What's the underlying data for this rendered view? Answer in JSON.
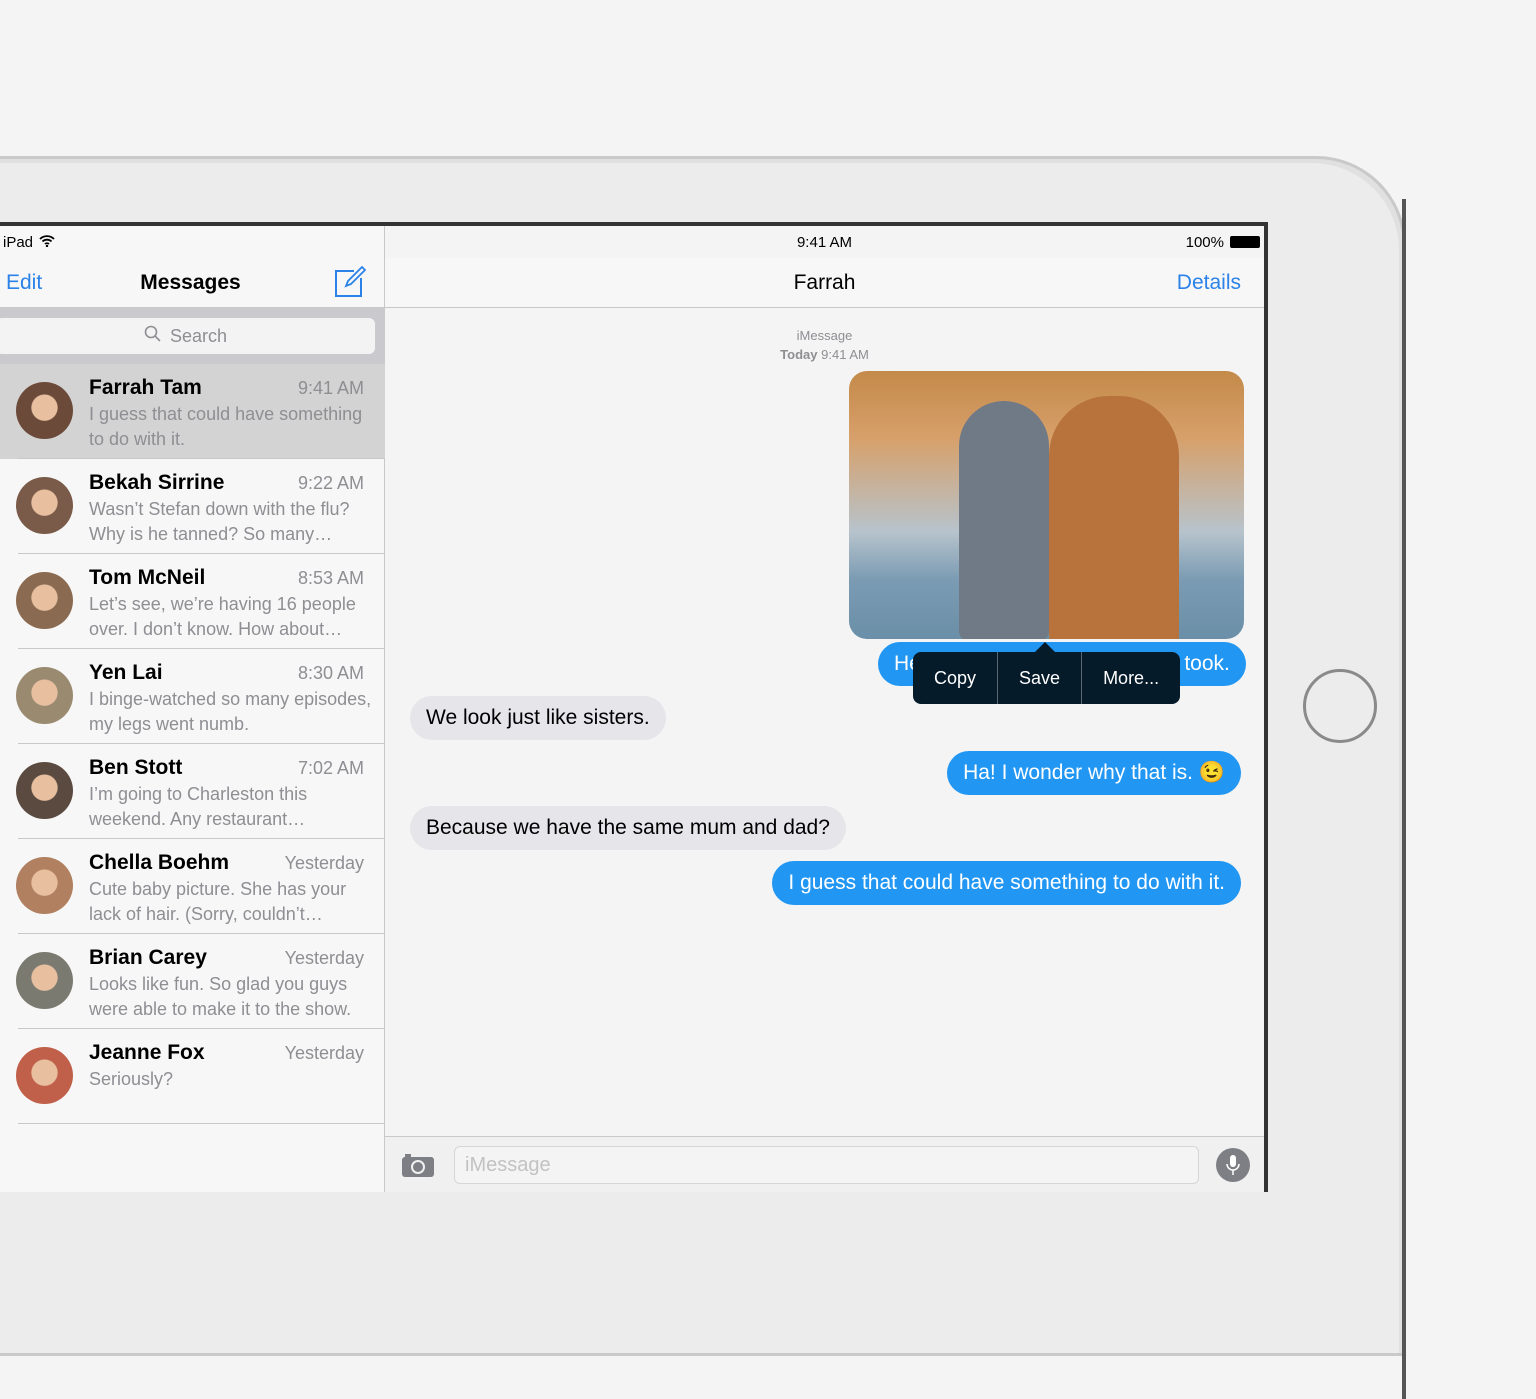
{
  "status": {
    "device": "iPad",
    "time": "9:41 AM",
    "battery": "100%"
  },
  "sidebar": {
    "edit": "Edit",
    "title": "Messages",
    "search_placeholder": "Search",
    "conversations": [
      {
        "name": "Farrah Tam",
        "time": "9:41 AM",
        "preview": "I guess that could have something to do with it.",
        "selected": true,
        "avatar_color": "#6b4a3a"
      },
      {
        "name": "Bekah Sirrine",
        "time": "9:22 AM",
        "preview": "Wasn’t Stefan down with the flu? Why is he tanned? So many…",
        "avatar_color": "#7a5a48"
      },
      {
        "name": "Tom McNeil",
        "time": "8:53 AM",
        "preview": "Let’s see, we’re having 16 people over. I don’t know. How about…",
        "avatar_color": "#8a6a50"
      },
      {
        "name": "Yen Lai",
        "time": "8:30 AM",
        "preview": "I binge-watched so many episodes, my legs went numb.",
        "avatar_color": "#9a8a70"
      },
      {
        "name": "Ben Stott",
        "time": "7:02 AM",
        "preview": "I’m going to Charleston this weekend. Any restaurant…",
        "avatar_color": "#5a4a40"
      },
      {
        "name": "Chella Boehm",
        "time": "Yesterday",
        "preview": "Cute baby picture. She has your lack of hair. (Sorry, couldn’t…",
        "avatar_color": "#b08060"
      },
      {
        "name": "Brian Carey",
        "time": "Yesterday",
        "preview": "Looks like fun. So glad you guys were able to make it to the show.",
        "avatar_color": "#7a7a70"
      },
      {
        "name": "Jeanne Fox",
        "time": "Yesterday",
        "preview": "Seriously?",
        "avatar_color": "#c0604a"
      }
    ]
  },
  "chat": {
    "title": "Farrah",
    "details": "Details",
    "service": "iMessage",
    "date_label": "Today",
    "date_time": "9:41 AM",
    "photo_caption": "Here’s a great photo that Anna took.",
    "menu": [
      "Copy",
      "Save",
      "More..."
    ],
    "messages": [
      {
        "dir": "in",
        "text": "We look just like sisters."
      },
      {
        "dir": "out",
        "text": "Ha! I wonder why that is. 😉"
      },
      {
        "dir": "in",
        "text": "Because we have the same mum and dad?"
      },
      {
        "dir": "out",
        "text": "I guess that could have something to do with it."
      }
    ],
    "input_placeholder": "iMessage"
  },
  "colors": {
    "accent": "#2b82e8",
    "outgoing": "#2196f3",
    "incoming": "#e5e5ea"
  }
}
